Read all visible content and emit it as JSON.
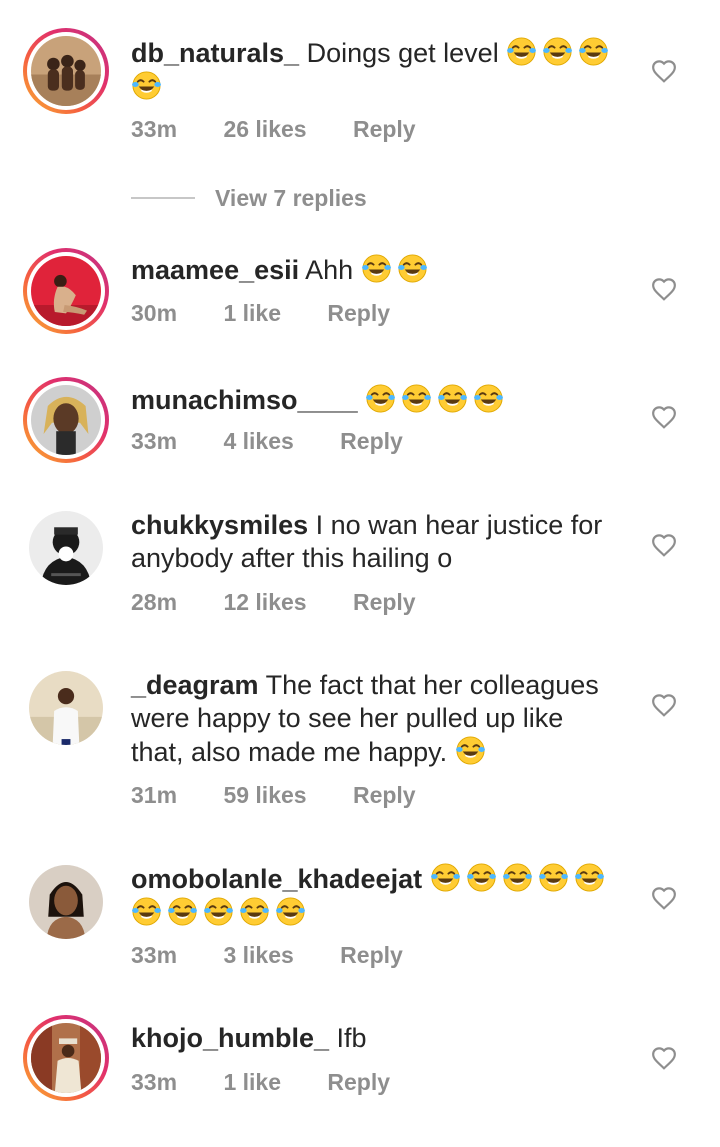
{
  "comments": [
    {
      "username": "db_naturals_",
      "text": "Doings get level",
      "emojis": 4,
      "time": "33m",
      "likes": "26 likes",
      "reply": "Reply"
    },
    {
      "username": "maamee_esii",
      "text": "Ahh",
      "emojis": 2,
      "time": "30m",
      "likes": "1 like",
      "reply": "Reply"
    },
    {
      "username": "munachimso____",
      "text": "",
      "emojis": 4,
      "time": "33m",
      "likes": "4 likes",
      "reply": "Reply"
    },
    {
      "username": "chukkysmiles",
      "text": "I no wan hear justice for anybody after this hailing o",
      "emojis": 0,
      "time": "28m",
      "likes": "12 likes",
      "reply": "Reply"
    },
    {
      "username": "_deagram",
      "text": "The fact that her colleagues were happy to see her pulled up like that, also made me happy.",
      "emojis": 1,
      "time": "31m",
      "likes": "59 likes",
      "reply": "Reply"
    },
    {
      "username": "omobolanle_khadeejat",
      "text": "",
      "emojis": 10,
      "time": "33m",
      "likes": "3 likes",
      "reply": "Reply"
    },
    {
      "username": "khojo_humble_",
      "text": "Ifb",
      "emojis": 0,
      "time": "33m",
      "likes": "1 like",
      "reply": "Reply"
    }
  ],
  "view_replies": "View 7 replies",
  "icons": {
    "emoji": "face-with-tears-of-joy-icon",
    "like": "heart-outline-icon"
  },
  "colors": {
    "text": "#262626",
    "meta": "#8e8e8e",
    "story_ring_start": "#f9b233",
    "story_ring_end": "#c13584"
  }
}
